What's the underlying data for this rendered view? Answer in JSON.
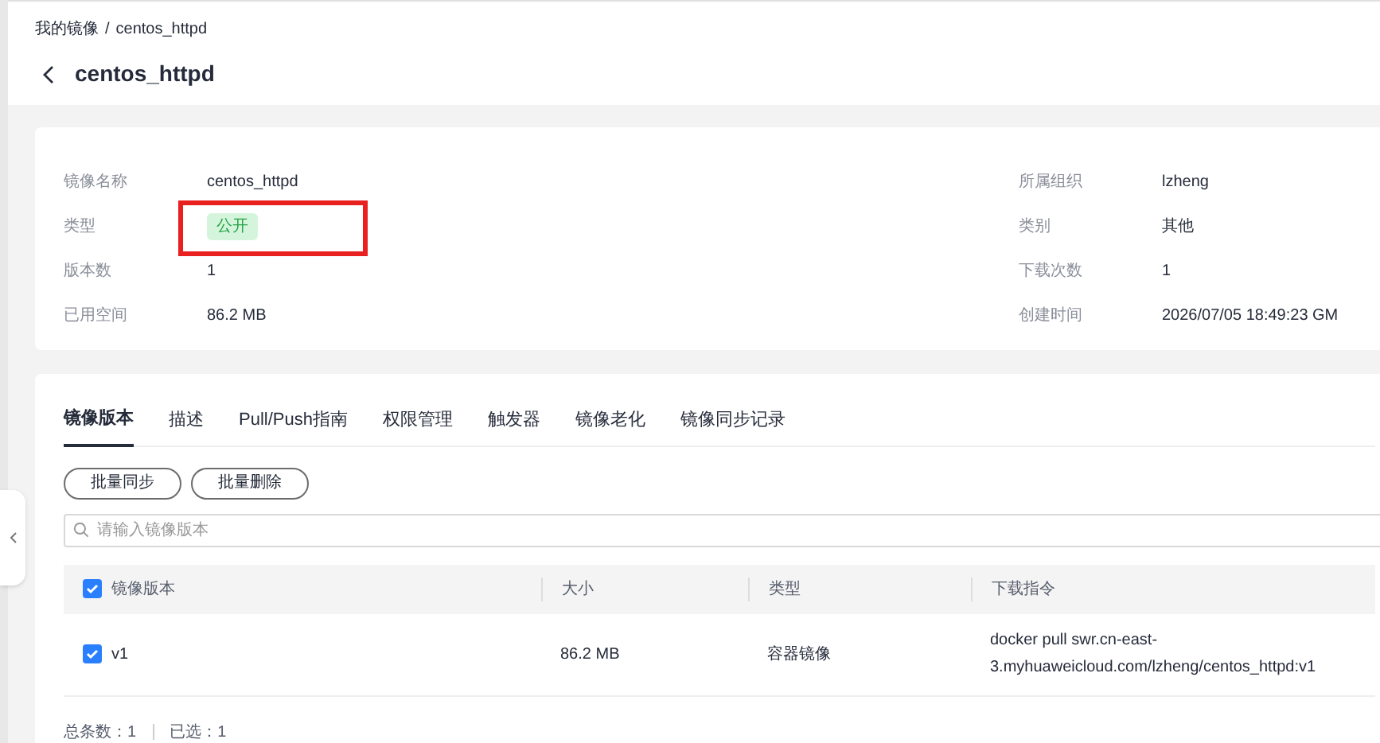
{
  "breadcrumb": {
    "parent": "我的镜像",
    "separator": "/",
    "current": "centos_httpd"
  },
  "title": "centos_httpd",
  "details_left": [
    {
      "label": "镜像名称",
      "value": "centos_httpd",
      "kind": "text"
    },
    {
      "label": "类型",
      "value": "公开",
      "kind": "tag"
    },
    {
      "label": "版本数",
      "value": "1",
      "kind": "text"
    },
    {
      "label": "已用空间",
      "value": "86.2 MB",
      "kind": "text"
    }
  ],
  "details_right": [
    {
      "label": "所属组织",
      "value": "lzheng",
      "kind": "text"
    },
    {
      "label": "类别",
      "value": "其他",
      "kind": "text"
    },
    {
      "label": "下载次数",
      "value": "1",
      "kind": "text"
    },
    {
      "label": "创建时间",
      "value": "2026/07/05 18:49:23 GM",
      "kind": "text"
    }
  ],
  "tabs": [
    {
      "label": "镜像版本",
      "selected": true
    },
    {
      "label": "描述",
      "selected": false
    },
    {
      "label": "Pull/Push指南",
      "selected": false
    },
    {
      "label": "权限管理",
      "selected": false
    },
    {
      "label": "触发器",
      "selected": false
    },
    {
      "label": "镜像老化",
      "selected": false
    },
    {
      "label": "镜像同步记录",
      "selected": false
    }
  ],
  "buttons": [
    "批量同步",
    "批量删除"
  ],
  "search": {
    "placeholder": "请输入镜像版本"
  },
  "table": {
    "select_all_checked": true,
    "columns": [
      "镜像版本",
      "大小",
      "类型",
      "下载指令"
    ],
    "rows": [
      {
        "checked": true,
        "cells": [
          "v1",
          "86.2 MB",
          "容器镜像",
          "docker pull swr.cn-east-3.myhuaweicloud.com/lzheng/centos_httpd:v1"
        ]
      }
    ]
  },
  "footer": {
    "total": "总条数：1",
    "selected": "已选：1"
  }
}
